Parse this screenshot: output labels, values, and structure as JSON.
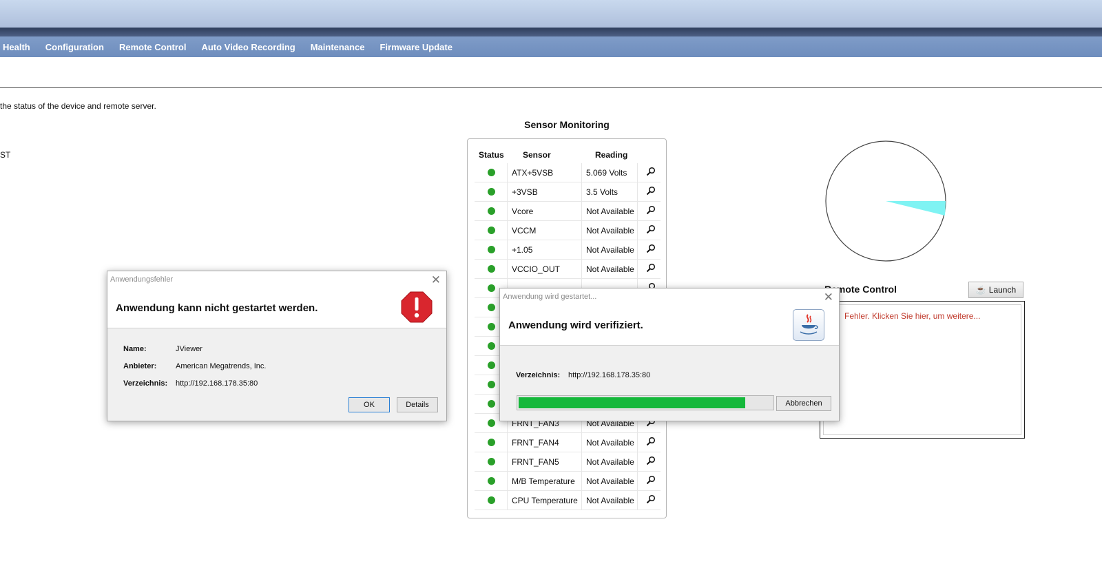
{
  "nav": {
    "items": [
      "Health",
      "Configuration",
      "Remote Control",
      "Auto Video Recording",
      "Maintenance",
      "Firmware Update"
    ]
  },
  "intro_text": "the status of the device and remote server.",
  "st_text": "ST",
  "sensor": {
    "title": "Sensor Monitoring",
    "headers": {
      "status": "Status",
      "sensor": "Sensor",
      "reading": "Reading"
    },
    "rows": [
      {
        "name": "ATX+5VSB",
        "reading": "5.069 Volts"
      },
      {
        "name": "+3VSB",
        "reading": "3.5 Volts"
      },
      {
        "name": "Vcore",
        "reading": "Not Available"
      },
      {
        "name": "VCCM",
        "reading": "Not Available"
      },
      {
        "name": "+1.05",
        "reading": "Not Available"
      },
      {
        "name": "VCCIO_OUT",
        "reading": "Not Available"
      },
      {
        "name": "",
        "reading": ""
      },
      {
        "name": "",
        "reading": ""
      },
      {
        "name": "",
        "reading": ""
      },
      {
        "name": "",
        "reading": ""
      },
      {
        "name": "",
        "reading": ""
      },
      {
        "name": "",
        "reading": ""
      },
      {
        "name": "",
        "reading": ""
      },
      {
        "name": "FRNT_FAN3",
        "reading": "Not Available"
      },
      {
        "name": "FRNT_FAN4",
        "reading": "Not Available"
      },
      {
        "name": "FRNT_FAN5",
        "reading": "Not Available"
      },
      {
        "name": "M/B Temperature",
        "reading": "Not Available"
      },
      {
        "name": "CPU Temperature",
        "reading": "Not Available"
      }
    ],
    "status_color": "#2aa02a"
  },
  "remote_control": {
    "title": "Remote Control",
    "launch_label": "Launch",
    "error_text": "Fehler. Klicken Sie hier, um weitere..."
  },
  "pie": {
    "slice_color": "#7ff3f3"
  },
  "error_dialog": {
    "titlebar": "Anwendungsfehler",
    "headline": "Anwendung kann nicht gestartet werden.",
    "name_label": "Name:",
    "name_value": "JViewer",
    "vendor_label": "Anbieter:",
    "vendor_value": "American Megatrends, Inc.",
    "dir_label": "Verzeichnis:",
    "dir_value": "http://192.168.178.35:80",
    "ok_label": "OK",
    "details_label": "Details",
    "icon": "error-icon"
  },
  "verify_dialog": {
    "titlebar": "Anwendung wird gestartet...",
    "headline": "Anwendung wird verifiziert.",
    "dir_label": "Verzeichnis:",
    "dir_value": "http://192.168.178.35:80",
    "progress": 0.9,
    "cancel_label": "Abbrechen",
    "icon": "java-icon",
    "progress_color": "#14b83a"
  }
}
